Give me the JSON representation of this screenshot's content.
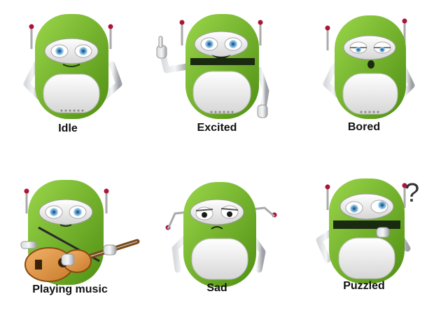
{
  "robots": [
    {
      "label": "Idle",
      "expression": "idle-expression"
    },
    {
      "label": "Excited",
      "expression": "excited-expression"
    },
    {
      "label": "Bored",
      "expression": "bored-expression"
    },
    {
      "label": "Playing music",
      "expression": "music-expression",
      "prop": "guitar-icon"
    },
    {
      "label": "Sad",
      "expression": "sad-expression"
    },
    {
      "label": "Puzzled",
      "expression": "puzzled-expression",
      "prop_text": "?"
    }
  ],
  "colors": {
    "body_green": "#7cc22a",
    "body_dark": "#5a9a18",
    "face_white": "#f2f2f2",
    "eye_blue": "#8ec9ef",
    "antenna_red": "#a8163a",
    "metal": "#b9bcc0"
  }
}
